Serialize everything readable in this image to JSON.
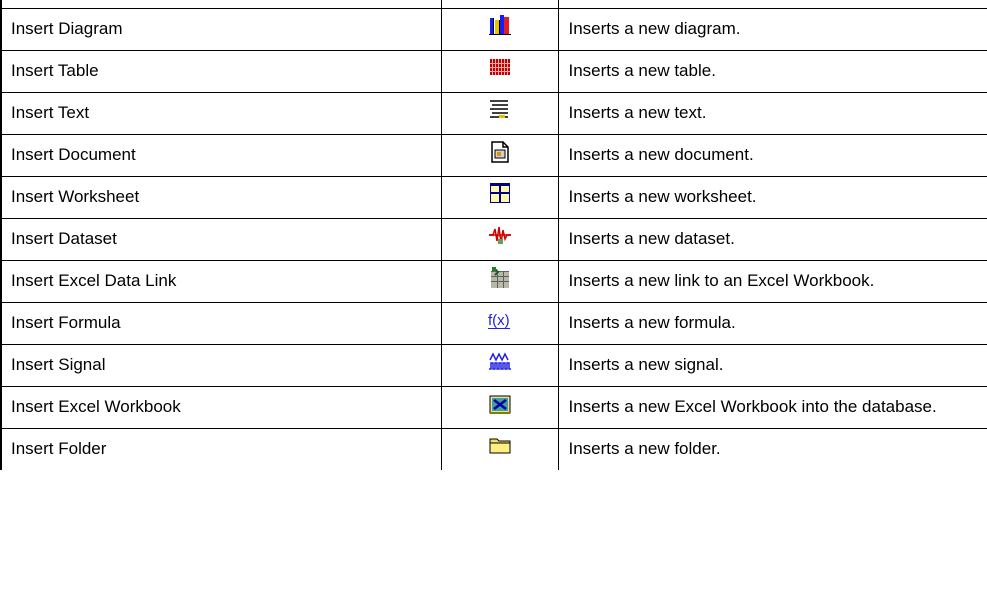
{
  "rows": [
    {
      "command": "Insert Diagram",
      "icon": "bar-chart-icon",
      "description": "Inserts a new diagram."
    },
    {
      "command": "Insert Table",
      "icon": "table-grid-icon",
      "description": "Inserts a new table."
    },
    {
      "command": "Insert Text",
      "icon": "text-lines-icon",
      "description": "Inserts a new text."
    },
    {
      "command": "Insert Document",
      "icon": "document-icon",
      "description": "Inserts a new document."
    },
    {
      "command": "Insert Worksheet",
      "icon": "worksheet-icon",
      "description": "Inserts a new worksheet."
    },
    {
      "command": "Insert Dataset",
      "icon": "dataset-wave-icon",
      "description": "Inserts a new dataset."
    },
    {
      "command": "Insert Excel Data Link",
      "icon": "excel-data-link-icon",
      "description": "Inserts a new link to an Excel Workbook."
    },
    {
      "command": "Insert Formula",
      "icon": "formula-icon",
      "description": "Inserts a new formula."
    },
    {
      "command": "Insert Signal",
      "icon": "signal-icon",
      "description": "Inserts a new signal."
    },
    {
      "command": "Insert Excel Workbook",
      "icon": "excel-workbook-icon",
      "description": "Inserts a new Excel Workbook into the database."
    },
    {
      "command": "Insert Folder",
      "icon": "folder-icon",
      "description": "Inserts a new folder."
    }
  ]
}
